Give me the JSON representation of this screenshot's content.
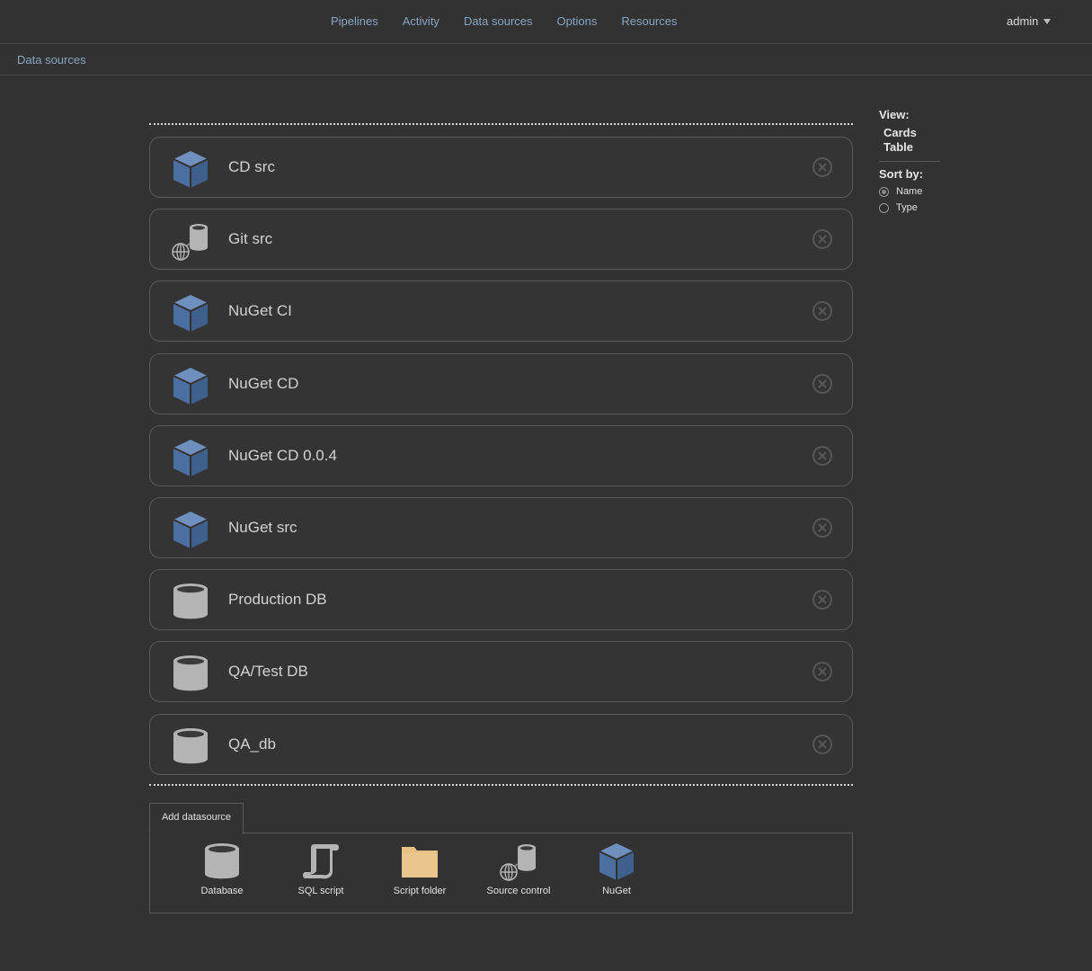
{
  "nav": {
    "links": [
      "Pipelines",
      "Activity",
      "Data sources",
      "Options",
      "Resources"
    ],
    "user": "admin"
  },
  "breadcrumb": "Data sources",
  "datasources": [
    {
      "name": "CD src",
      "icon": "nuget-icon"
    },
    {
      "name": "Git src",
      "icon": "source-control-icon"
    },
    {
      "name": "NuGet CI",
      "icon": "nuget-icon"
    },
    {
      "name": "NuGet CD",
      "icon": "nuget-icon"
    },
    {
      "name": "NuGet CD 0.0.4",
      "icon": "nuget-icon"
    },
    {
      "name": "NuGet src",
      "icon": "nuget-icon"
    },
    {
      "name": "Production DB",
      "icon": "database-icon"
    },
    {
      "name": "QA/Test DB",
      "icon": "database-icon"
    },
    {
      "name": "QA_db",
      "icon": "database-icon"
    }
  ],
  "add": {
    "tab_label": "Add datasource",
    "types": [
      {
        "label": "Database",
        "icon": "database-icon"
      },
      {
        "label": "SQL script",
        "icon": "sql-script-icon"
      },
      {
        "label": "Script folder",
        "icon": "folder-icon"
      },
      {
        "label": "Source control",
        "icon": "source-control-icon"
      },
      {
        "label": "NuGet",
        "icon": "nuget-icon"
      }
    ]
  },
  "sidebar": {
    "view_label": "View:",
    "view_options": [
      "Cards",
      "Table"
    ],
    "sort_label": "Sort by:",
    "sort_options": [
      {
        "label": "Name",
        "selected": true
      },
      {
        "label": "Type",
        "selected": false
      }
    ]
  },
  "colors": {
    "background": "#323232",
    "link": "#88a4c4",
    "nuget_blue": "#4a6fa0",
    "folder": "#e7c184",
    "db_gray": "#b4b4b4"
  }
}
